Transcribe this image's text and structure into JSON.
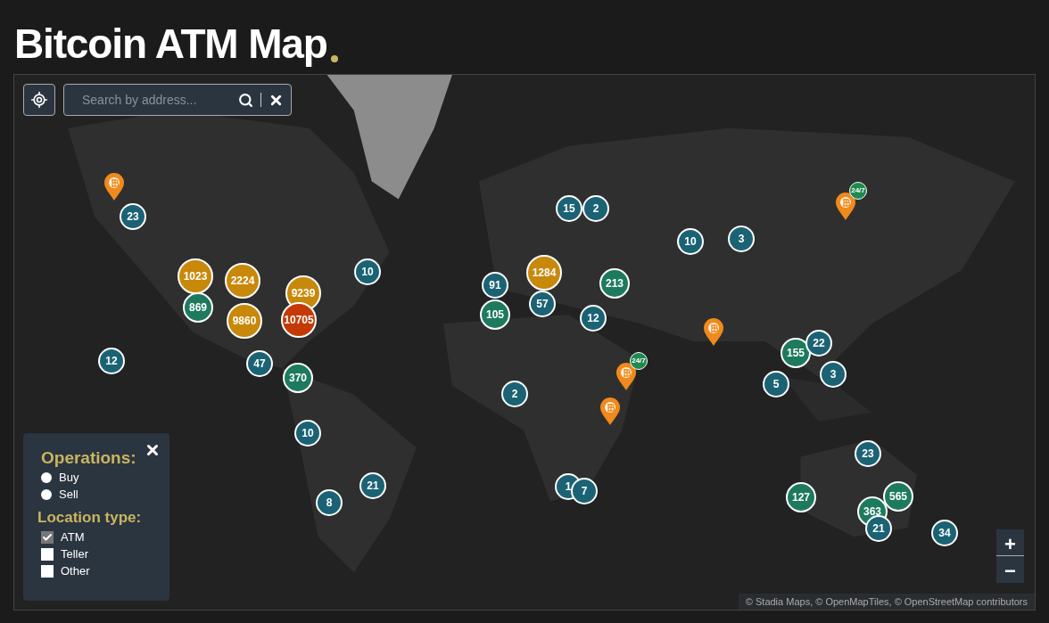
{
  "title": "Bitcoin ATM Map",
  "search": {
    "placeholder": "Search by address..."
  },
  "clusters": [
    {
      "count": "23",
      "color": "#1b6374"
    },
    {
      "count": "1023",
      "color": "#c8880a"
    },
    {
      "count": "2224",
      "color": "#c8880a"
    },
    {
      "count": "869",
      "color": "#1e7a5e"
    },
    {
      "count": "9860",
      "color": "#c8880a"
    },
    {
      "count": "9239",
      "color": "#c8880a"
    },
    {
      "count": "10705",
      "color": "#c33a06"
    },
    {
      "count": "10",
      "color": "#1b6374"
    },
    {
      "count": "12",
      "color": "#1b6374"
    },
    {
      "count": "47",
      "color": "#1b6374"
    },
    {
      "count": "370",
      "color": "#1e7a5e"
    },
    {
      "count": "10",
      "color": "#1b6374"
    },
    {
      "count": "21",
      "color": "#1b6374"
    },
    {
      "count": "8",
      "color": "#1b6374"
    },
    {
      "count": "15",
      "color": "#1b6374"
    },
    {
      "count": "2",
      "color": "#1b6374"
    },
    {
      "count": "1284",
      "color": "#c8880a"
    },
    {
      "count": "91",
      "color": "#1b6374"
    },
    {
      "count": "105",
      "color": "#1e7a5e"
    },
    {
      "count": "57",
      "color": "#1b6374"
    },
    {
      "count": "213",
      "color": "#1e7a5e"
    },
    {
      "count": "12",
      "color": "#1b6374"
    },
    {
      "count": "10",
      "color": "#1b6374"
    },
    {
      "count": "3",
      "color": "#1b6374"
    },
    {
      "count": "2",
      "color": "#1b6374"
    },
    {
      "count": "155",
      "color": "#1e7a5e"
    },
    {
      "count": "22",
      "color": "#1b6374"
    },
    {
      "count": "5",
      "color": "#1b6374"
    },
    {
      "count": "3",
      "color": "#1b6374"
    },
    {
      "count": "23",
      "color": "#1b6374"
    },
    {
      "count": "127",
      "color": "#1e7a5e"
    },
    {
      "count": "565",
      "color": "#1e7a5e"
    },
    {
      "count": "363",
      "color": "#1e7a5e"
    },
    {
      "count": "21",
      "color": "#1b6374"
    },
    {
      "count": "34",
      "color": "#1b6374"
    },
    {
      "count": "1",
      "color": "#1b6374"
    },
    {
      "count": "7",
      "color": "#1b6374"
    }
  ],
  "pins": [
    {
      "kind": "plain"
    },
    {
      "kind": "badged",
      "badge": "24/7"
    },
    {
      "kind": "plain"
    },
    {
      "kind": "badged",
      "badge": "24/7"
    },
    {
      "kind": "plain"
    }
  ],
  "filters": {
    "operations_title": "Operations:",
    "operations": [
      {
        "label": "Buy",
        "selected": false
      },
      {
        "label": "Sell",
        "selected": false
      }
    ],
    "location_title": "Location type:",
    "locations": [
      {
        "label": "ATM",
        "checked": true
      },
      {
        "label": "Teller",
        "checked": false
      },
      {
        "label": "Other",
        "checked": false
      }
    ]
  },
  "zoom": {
    "in": "+",
    "out": "−"
  },
  "attribution": "© Stadia Maps, © OpenMapTiles, © OpenStreetMap contributors"
}
